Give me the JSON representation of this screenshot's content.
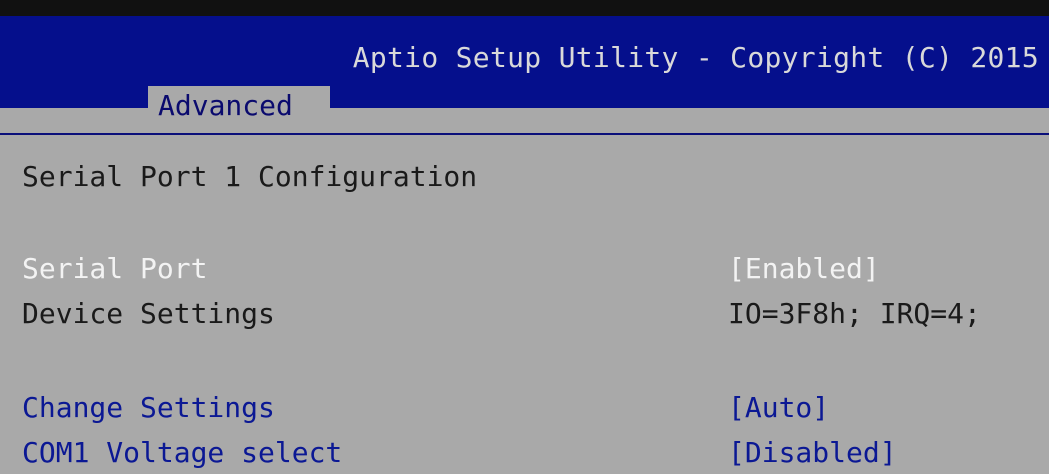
{
  "header": {
    "title": "Aptio Setup Utility - Copyright (C) 2015"
  },
  "tabs": [
    {
      "label": "Advanced",
      "selected": true
    }
  ],
  "page": {
    "heading": "Serial Port 1 Configuration"
  },
  "settings": [
    {
      "label": "Serial Port",
      "value": "[Enabled]"
    },
    {
      "label": "Device Settings",
      "value": "IO=3F8h; IRQ=4;"
    },
    {
      "label": "Change Settings",
      "value": "[Auto]"
    },
    {
      "label": "COM1 Voltage select",
      "value": "[Disabled]"
    }
  ],
  "colors": {
    "header_bg": "#050f8c",
    "body_bg": "#a9a9a9",
    "selected_text": "#f3f3f3",
    "normal_text": "#1a1a1a",
    "configurable_text": "#0b1894"
  }
}
